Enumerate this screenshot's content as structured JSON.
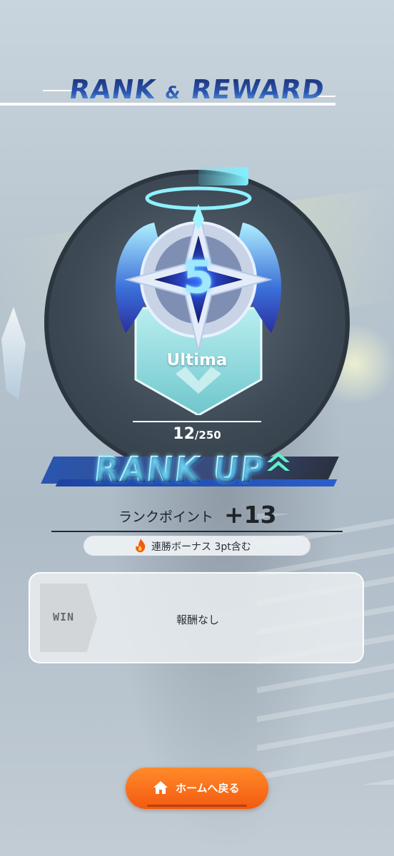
{
  "header": {
    "title_main": "RANK",
    "title_amp": "&",
    "title_end": "REWARD"
  },
  "rank": {
    "tier_number": "5",
    "tier_name": "Ultima",
    "points_current": "12",
    "points_max": "/250"
  },
  "rank_up": {
    "label": "RANK UP"
  },
  "rank_points": {
    "label": "ランクポイント",
    "value": "+13"
  },
  "bonus": {
    "text": "連勝ボーナス 3pt含む"
  },
  "reward": {
    "tag": "WIN",
    "content": "報酬なし"
  },
  "home_button": {
    "label": "ホームへ戻る"
  },
  "colors": {
    "accent_orange": "#f35a10",
    "title_blue": "#1b3a86",
    "rank_up_cyan": "#7ff3f0"
  },
  "icons": [
    "rank-emblem-icon",
    "double-chevron-up-icon",
    "flame-icon",
    "home-icon"
  ]
}
